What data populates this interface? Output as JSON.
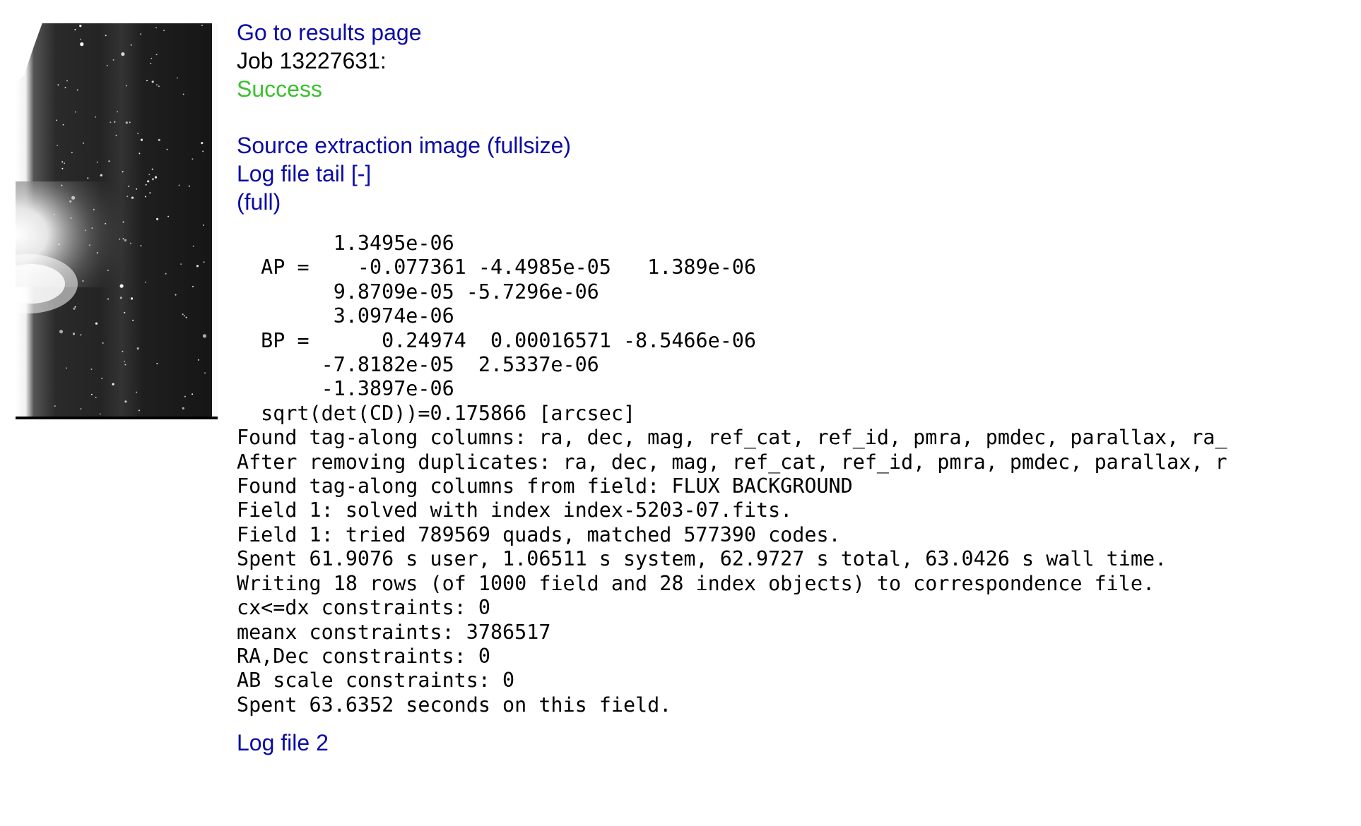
{
  "header": {
    "results_link": "Go to results page",
    "job_label": "Job 13227631:",
    "status": "Success",
    "status_color": "#3cc02e"
  },
  "links": {
    "source_extraction": "Source extraction image (fullsize)",
    "log_tail": "Log file tail [-]",
    "log_full": "(full)",
    "log_file_2": "Log file 2"
  },
  "thumbnail": {
    "icon": "source-extraction-thumbnail"
  },
  "log": {
    "lines": [
      "        1.3495e-06",
      "  AP =    -0.077361 -4.4985e-05   1.389e-06",
      "        9.8709e-05 -5.7296e-06",
      "        3.0974e-06",
      "  BP =      0.24974  0.00016571 -8.5466e-06",
      "       -7.8182e-05  2.5337e-06",
      "       -1.3897e-06",
      "  sqrt(det(CD))=0.175866 [arcsec]",
      "Found tag-along columns: ra, dec, mag, ref_cat, ref_id, pmra, pmdec, parallax, ra_",
      "After removing duplicates: ra, dec, mag, ref_cat, ref_id, pmra, pmdec, parallax, r",
      "Found tag-along columns from field: FLUX BACKGROUND",
      "Field 1: solved with index index-5203-07.fits.",
      "Field 1: tried 789569 quads, matched 577390 codes.",
      "Spent 61.9076 s user, 1.06511 s system, 62.9727 s total, 63.0426 s wall time.",
      "Writing 18 rows (of 1000 field and 28 index objects) to correspondence file.",
      "cx<=dx constraints: 0",
      "meanx constraints: 3786517",
      "RA,Dec constraints: 0",
      "AB scale constraints: 0",
      "Spent 63.6352 seconds on this field."
    ]
  }
}
